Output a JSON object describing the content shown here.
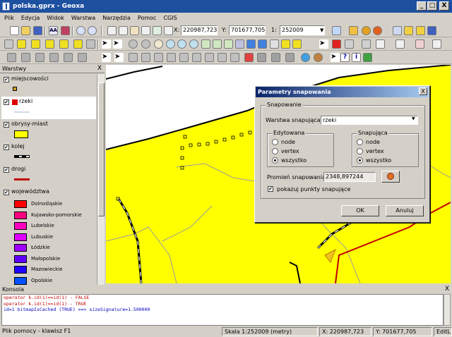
{
  "window": {
    "title": "polska.gprx - Geoxa",
    "minimize": "_",
    "maximize": "□",
    "close": "X"
  },
  "menu": [
    "Plik",
    "Edycja",
    "Widok",
    "Warstwa",
    "Narzędzia",
    "Pomoc",
    "CGIS"
  ],
  "toolbar": {
    "x_label": "X:",
    "x_value": "220987,723",
    "y_label": "Y:",
    "y_value": "701677,705",
    "scale_prefix": "1:",
    "scale_value": "252009"
  },
  "layers_panel": {
    "title": "Warstwy",
    "close": "X",
    "layers": [
      {
        "name": "miejscowości",
        "checked": true,
        "symbol": "point",
        "color": "#d4a020"
      },
      {
        "name": "rzeki",
        "checked": true,
        "symbol": "line",
        "color": "#d0d8e8",
        "swatch": "#e00000",
        "selected": true
      },
      {
        "name": "obrysy-miast",
        "checked": true,
        "symbol": "fill",
        "color": "#ffff00"
      },
      {
        "name": "kolej",
        "checked": true,
        "symbol": "rail",
        "color": "#000000"
      },
      {
        "name": "drogi",
        "checked": true,
        "symbol": "line",
        "color": "#c00000"
      },
      {
        "name": "województwa",
        "checked": true,
        "symbol": "group",
        "color": "#000000"
      }
    ],
    "voivodeships": [
      {
        "name": "Dolnośląskie",
        "color": "#ff0000"
      },
      {
        "name": "Kujawsko-pomorskie",
        "color": "#ff0080"
      },
      {
        "name": "Lubelskie",
        "color": "#ff00c0"
      },
      {
        "name": "Lubuskie",
        "color": "#e000ff"
      },
      {
        "name": "Łódzkie",
        "color": "#a000ff"
      },
      {
        "name": "Małopolskie",
        "color": "#6000ff"
      },
      {
        "name": "Mazowieckie",
        "color": "#2000ff"
      },
      {
        "name": "Opolskie",
        "color": "#0050ff"
      }
    ]
  },
  "dialog": {
    "title": "Parametry snapowania",
    "close": "X",
    "group_label": "Snapowanie",
    "layer_label": "Warstwa snapująca:",
    "layer_value": "rzeki",
    "edited_label": "Edytowana",
    "snapping_label": "Snapująca",
    "options": [
      "node",
      "vertex",
      "wszystko"
    ],
    "edited_selected": 2,
    "snapping_selected": 2,
    "radius_label": "Promień snapowania:",
    "radius_value": "2348,897244",
    "show_points_label": "pokazuj punkty snapujące",
    "show_points_checked": true,
    "ok": "OK",
    "cancel": "Anuluj"
  },
  "console": {
    "title": "Konsola",
    "close": "X",
    "lines": [
      {
        "text": "operator k.id(1)==id(1) - FALSE",
        "color": "red"
      },
      {
        "text": "operator k.id(1)==id(1) - TRUE",
        "color": "red"
      },
      {
        "text": " id=1 bitmapIsCached (TRUE) ==> sizeSignature=1.500000",
        "color": "blue"
      }
    ]
  },
  "status": {
    "help": "Plik pomocy - klawisz F1",
    "scale": "Skala 1:252009 (metry)",
    "x": "X: 220987,723",
    "y": "Y: 701677,705",
    "mode": "EditL"
  },
  "colors": {
    "land": "#ffff00",
    "border": "#9c9c9c",
    "river": "#d0d8e8"
  }
}
